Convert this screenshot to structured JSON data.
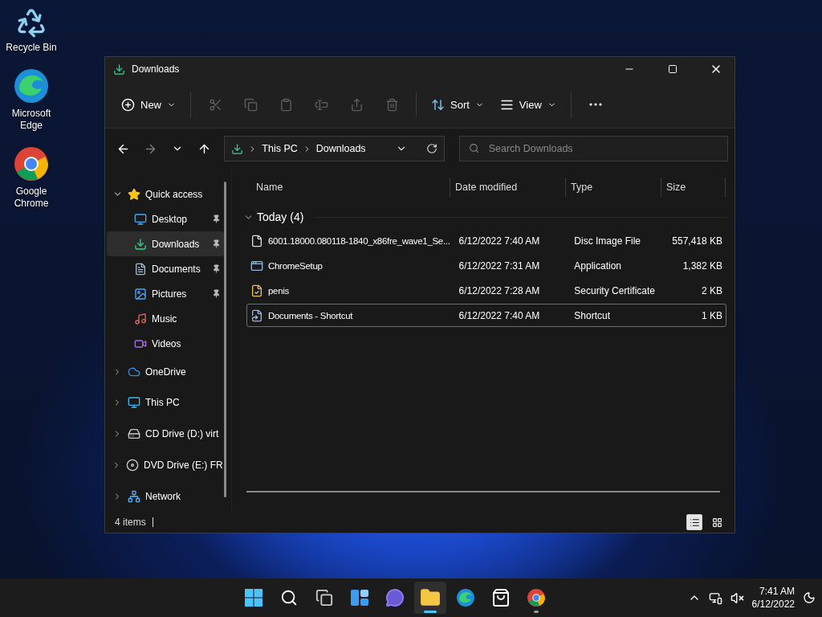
{
  "desktop_icons": [
    {
      "kind": "recycle",
      "label": "Recycle Bin"
    },
    {
      "kind": "edge",
      "label": "Microsoft Edge"
    },
    {
      "kind": "chrome",
      "label": "Google Chrome"
    }
  ],
  "window": {
    "title": "Downloads",
    "toolbar": [
      {
        "kind": "new",
        "label": "New",
        "disabled": false
      },
      {
        "kind": "cut",
        "disabled": true
      },
      {
        "kind": "copy",
        "disabled": true
      },
      {
        "kind": "paste",
        "disabled": true
      },
      {
        "kind": "rename",
        "disabled": true
      },
      {
        "kind": "share",
        "disabled": true
      },
      {
        "kind": "delete",
        "disabled": true
      },
      {
        "kind": "sort",
        "label": "Sort",
        "disabled": false
      },
      {
        "kind": "view",
        "label": "View",
        "disabled": false
      },
      {
        "kind": "more",
        "disabled": false
      }
    ],
    "nav": [
      {
        "kind": "back",
        "disabled": false
      },
      {
        "kind": "forward",
        "disabled": true
      },
      {
        "kind": "recent",
        "disabled": false
      },
      {
        "kind": "up",
        "disabled": false
      }
    ],
    "address": {
      "segments": [
        "This PC",
        "Downloads"
      ]
    },
    "search": {
      "placeholder": "Search Downloads"
    },
    "sidebar": [
      {
        "kind": "star",
        "label": "Quick access",
        "expanded": true,
        "selected": false,
        "children": [
          {
            "kind": "desktop",
            "label": "Desktop",
            "pinned": true,
            "selected": false
          },
          {
            "kind": "download",
            "label": "Downloads",
            "pinned": true,
            "selected": true
          },
          {
            "kind": "documents",
            "label": "Documents",
            "pinned": true,
            "selected": false
          },
          {
            "kind": "pictures",
            "label": "Pictures",
            "pinned": true,
            "selected": false
          },
          {
            "kind": "music",
            "label": "Music",
            "pinned": false,
            "selected": false
          },
          {
            "kind": "videos",
            "label": "Videos",
            "pinned": false,
            "selected": false
          }
        ]
      },
      {
        "kind": "cloud",
        "label": "OneDrive",
        "expanded": false,
        "selected": false
      },
      {
        "kind": "pc",
        "label": "This PC",
        "expanded": false,
        "selected": false
      },
      {
        "kind": "cd",
        "label": "CD Drive (D:) virt",
        "expanded": false,
        "selected": false
      },
      {
        "kind": "dvd",
        "label": "DVD Drive (E:) FR",
        "expanded": false,
        "selected": false
      },
      {
        "kind": "network",
        "label": "Network",
        "expanded": false,
        "selected": false
      }
    ],
    "columns": [
      "Name",
      "Date modified",
      "Type",
      "Size"
    ],
    "group": {
      "label": "Today (4)",
      "expanded": true
    },
    "rows": [
      {
        "kind": "disc",
        "name": "6001.18000.080118-1840_x86fre_wave1_Se...",
        "date": "6/12/2022 7:40 AM",
        "type": "Disc Image File",
        "size": "557,418 KB",
        "selected": false
      },
      {
        "kind": "app",
        "name": "ChromeSetup",
        "date": "6/12/2022 7:31 AM",
        "type": "Application",
        "size": "1,382 KB",
        "selected": false
      },
      {
        "kind": "cert",
        "name": "penis",
        "date": "6/12/2022 7:28 AM",
        "type": "Security Certificate",
        "size": "2 KB",
        "selected": false
      },
      {
        "kind": "shortcut",
        "name": "Documents - Shortcut",
        "date": "6/12/2022 7:40 AM",
        "type": "Shortcut",
        "size": "1 KB",
        "selected": true
      }
    ],
    "status_bar": {
      "item_count": "4 items"
    },
    "view_modes": [
      {
        "kind": "details",
        "selected": true
      },
      {
        "kind": "tiles",
        "selected": false
      }
    ]
  },
  "taskbar": {
    "apps": [
      {
        "kind": "start",
        "selected": false,
        "running": false
      },
      {
        "kind": "search",
        "selected": false,
        "running": false
      },
      {
        "kind": "taskview",
        "selected": false,
        "running": false
      },
      {
        "kind": "widgets",
        "selected": false,
        "running": false
      },
      {
        "kind": "chat",
        "selected": false,
        "running": false
      },
      {
        "kind": "explorer",
        "selected": true,
        "running": true
      },
      {
        "kind": "edge",
        "selected": false,
        "running": false
      },
      {
        "kind": "store",
        "selected": false,
        "running": false
      },
      {
        "kind": "chrome",
        "selected": false,
        "running": true
      }
    ],
    "time": "7:41 AM",
    "date": "6/12/2022"
  }
}
